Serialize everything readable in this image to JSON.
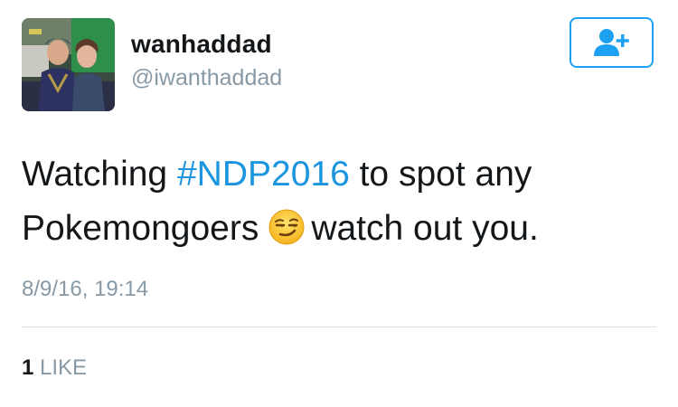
{
  "user": {
    "display_name": "wanhaddad",
    "handle": "@iwanthaddad"
  },
  "follow_button": {
    "icon": "add-user-icon"
  },
  "tweet": {
    "text_before": "Watching ",
    "hashtag": "#NDP2016",
    "text_middle": " to spot any Pokemongoers",
    "emoji_name": "smirking-face-emoji",
    "text_after": "watch out you."
  },
  "timestamp": "8/9/16, 19:14",
  "likes": {
    "count": "1",
    "label": " LIKE"
  },
  "colors": {
    "accent": "#1da1f2",
    "hashtag": "#1b95e0",
    "text": "#14171a",
    "secondary": "#8899a6"
  }
}
